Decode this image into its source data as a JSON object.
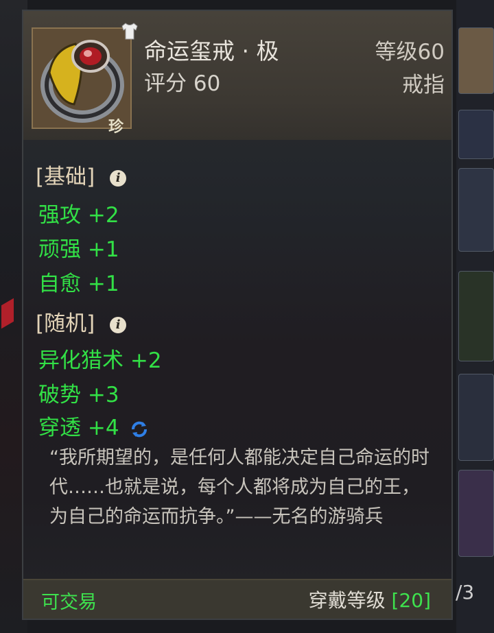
{
  "item": {
    "name": "命运玺戒 · 极",
    "score": "评分 60",
    "level": "等级60",
    "slot_type": "戒指",
    "rarity_tag": "珍",
    "armor_icon": "shirt-icon"
  },
  "sections": {
    "base_label": "[基础]",
    "random_label": "[随机]"
  },
  "base_stats": [
    "强攻 +2",
    "顽强 +1",
    "自愈 +1"
  ],
  "random_stats": [
    "异化猎术 +2",
    "破势 +3",
    "穿透 +4"
  ],
  "quote": "“我所期望的，是任何人都能决定自己命运的时代……也就是说，每个人都将成为自己的王，为自己的命运而抗争。”——无名的游骑兵",
  "footer": {
    "tradable": "可交易",
    "wear_label": "穿戴等级",
    "wear_level": "[20]"
  },
  "side_count": "/3",
  "colors": {
    "stat_green": "#32e046",
    "refresh_blue": "#2f7fe6"
  }
}
